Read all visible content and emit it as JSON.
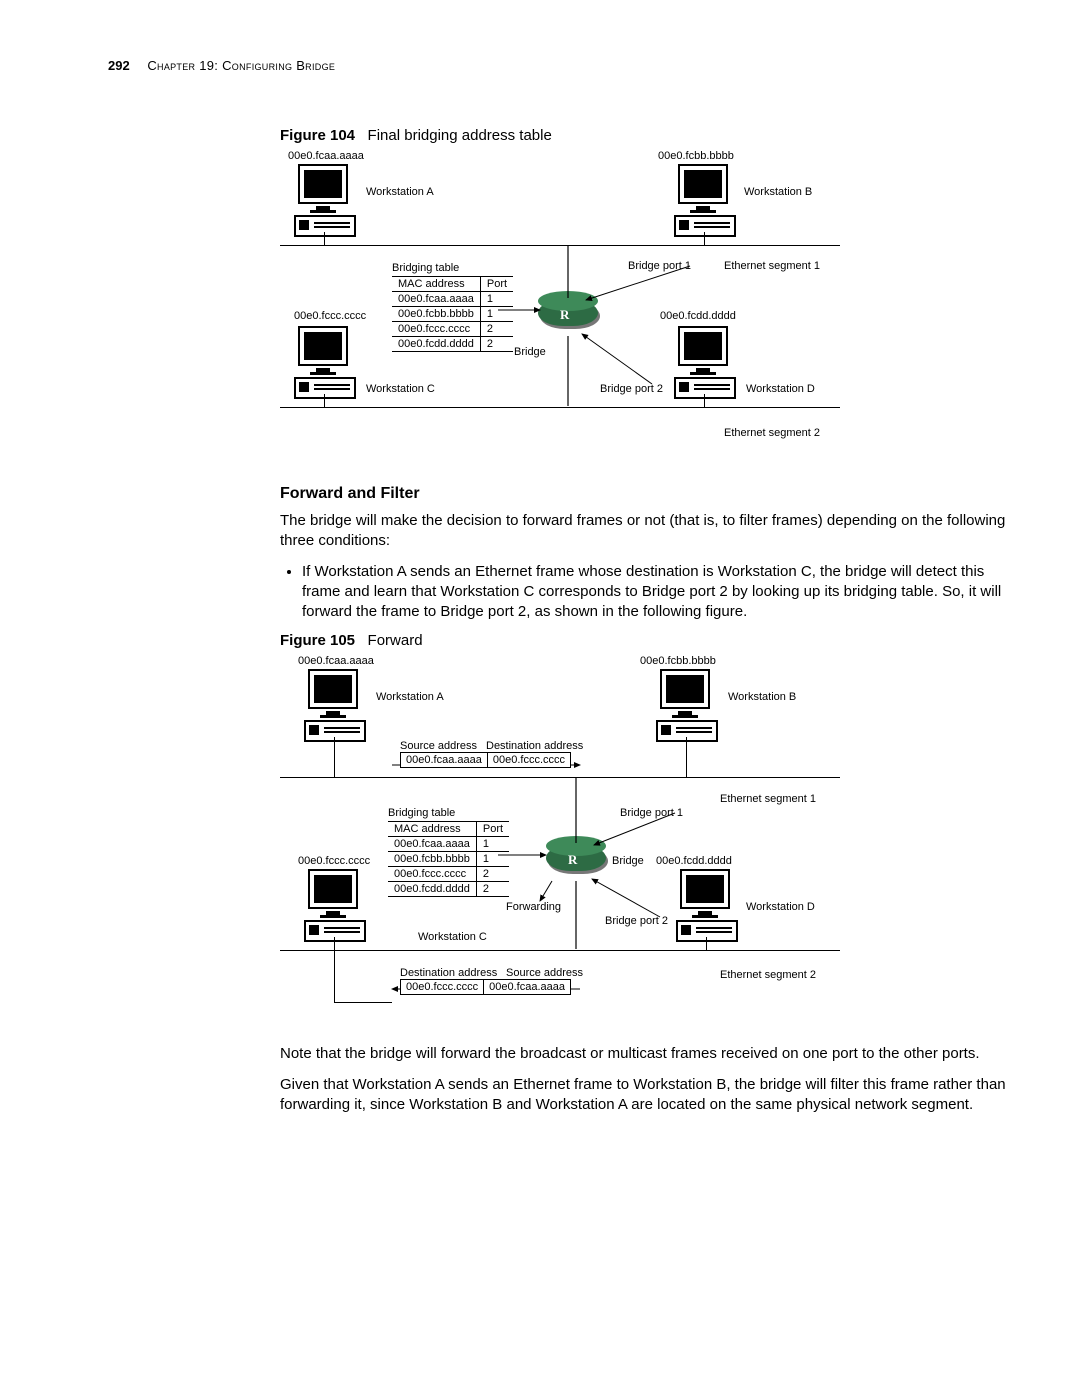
{
  "header": {
    "page_number": "292",
    "chapter": "Chapter 19: Configuring Bridge"
  },
  "figure104": {
    "caption_label": "Figure 104",
    "caption_text": "Final bridging address table",
    "macA": "00e0.fcaa.aaaa",
    "macB": "00e0.fcbb.bbbb",
    "macC": "00e0.fccc.cccc",
    "macD": "00e0.fcdd.dddd",
    "wsA": "Workstation A",
    "wsB": "Workstation B",
    "wsC": "Workstation C",
    "wsD": "Workstation D",
    "seg1": "Ethernet segment 1",
    "seg2": "Ethernet segment 2",
    "bridge": "Bridge",
    "port1": "Bridge port 1",
    "port2": "Bridge port 2",
    "table_title": "Bridging table",
    "table_hdr_mac": "MAC  address",
    "table_hdr_port": "Port",
    "rows": [
      {
        "mac": "00e0.fcaa.aaaa",
        "port": "1"
      },
      {
        "mac": "00e0.fcbb.bbbb",
        "port": "1"
      },
      {
        "mac": "00e0.fccc.cccc",
        "port": "2"
      },
      {
        "mac": "00e0.fcdd.dddd",
        "port": "2"
      }
    ]
  },
  "forward_filter": {
    "heading": "Forward and Filter",
    "intro": "The bridge will make the decision to forward frames or not (that is, to filter frames) depending on the following three conditions:",
    "bullet1": "If Workstation A sends an Ethernet frame whose destination is Workstation C, the bridge will detect this frame and learn that Workstation C corresponds to Bridge port 2 by looking up its bridging table. So, it will forward the frame to Bridge port 2, as shown in the following figure."
  },
  "figure105": {
    "caption_label": "Figure 105",
    "caption_text": "Forward",
    "macA": "00e0.fcaa.aaaa",
    "macB": "00e0.fcbb.bbbb",
    "macC": "00e0.fccc.cccc",
    "macD": "00e0.fcdd.dddd",
    "wsA": "Workstation A",
    "wsB": "Workstation B",
    "wsC": "Workstation C",
    "wsD": "Workstation D",
    "seg1": "Ethernet segment 1",
    "seg2": "Ethernet segment 2",
    "bridge": "Bridge",
    "port1": "Bridge port 1",
    "port2": "Bridge port 2",
    "forwarding": "Forwarding",
    "frame_top": {
      "src_label": "Source address",
      "dst_label": "Destination address",
      "src": "00e0.fcaa.aaaa",
      "dst": "00e0.fccc.cccc"
    },
    "frame_bot": {
      "dst_label": "Destination address",
      "src_label": "Source address",
      "dst": "00e0.fccc.cccc",
      "src": "00e0.fcaa.aaaa"
    },
    "table_title": "Bridging table",
    "table_hdr_mac": "MAC  address",
    "table_hdr_port": "Port",
    "rows": [
      {
        "mac": "00e0.fcaa.aaaa",
        "port": "1"
      },
      {
        "mac": "00e0.fcbb.bbbb",
        "port": "1"
      },
      {
        "mac": "00e0.fccc.cccc",
        "port": "2"
      },
      {
        "mac": "00e0.fcdd.dddd",
        "port": "2"
      }
    ]
  },
  "trailing": {
    "p1": "Note that the bridge will forward the broadcast or multicast frames received on one port to the other ports.",
    "p2": "Given that Workstation A sends an Ethernet frame to Workstation B, the bridge will filter this frame rather than forwarding it, since Workstation B and Workstation A are located on the same physical network segment."
  }
}
